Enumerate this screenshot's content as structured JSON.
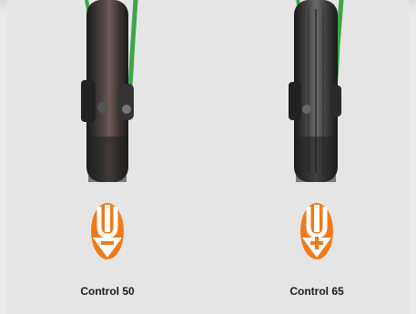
{
  "products": [
    {
      "name": "Control 50",
      "icon": "tire-deflate-minus-icon",
      "symbol": "-"
    },
    {
      "name": "Control 65",
      "icon": "tire-inflate-plus-icon",
      "symbol": "+"
    }
  ],
  "colors": {
    "background": "#ebebeb",
    "accent": "#f07a1a",
    "tire": "#2a2a2a",
    "frame": "#3aa64a"
  }
}
